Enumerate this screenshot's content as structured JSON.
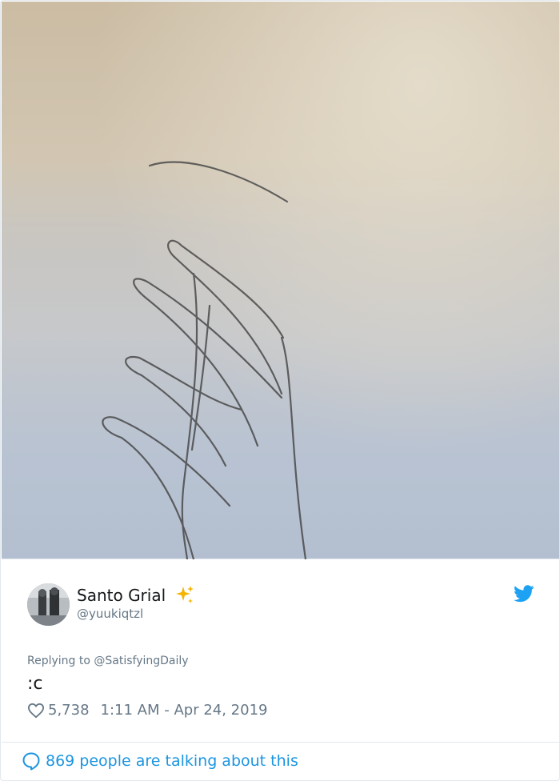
{
  "tweet": {
    "display_name": "Santo Grial",
    "handle": "@yuukiqtzl",
    "replying_to": "Replying to @SatisfyingDaily",
    "text": ":c",
    "likes": "5,738",
    "timestamp": "1:11 AM - Apr 24, 2019",
    "talking": "869 people are talking about this"
  },
  "icons": {
    "sparkle": "sparkles-icon",
    "bird": "twitter-bird-icon",
    "heart": "heart-icon",
    "bubble": "speech-bubble-icon"
  },
  "colors": {
    "accent": "#1b95e0",
    "secondary_text": "#657786",
    "sparkle": "#f4b400"
  }
}
